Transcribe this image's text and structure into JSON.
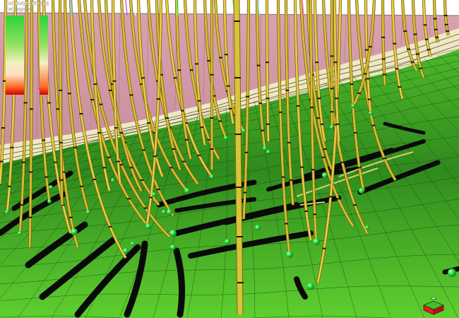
{
  "legend": {
    "title": "Cell height (Seam)",
    "subtitle": "Cell height [m]"
  },
  "colors": {
    "sky": "#ffffff",
    "cliff": "#d9a2ae",
    "band_light": "#efe8c4",
    "surface_dark": "#1c6a12",
    "surface_light": "#6fd03a",
    "well_yellow": "#e3c63a",
    "horizontal": "#0a0a0a",
    "well_marker": "#2ee64a"
  },
  "icons": {
    "orientation": "orientation-cube-icon"
  }
}
